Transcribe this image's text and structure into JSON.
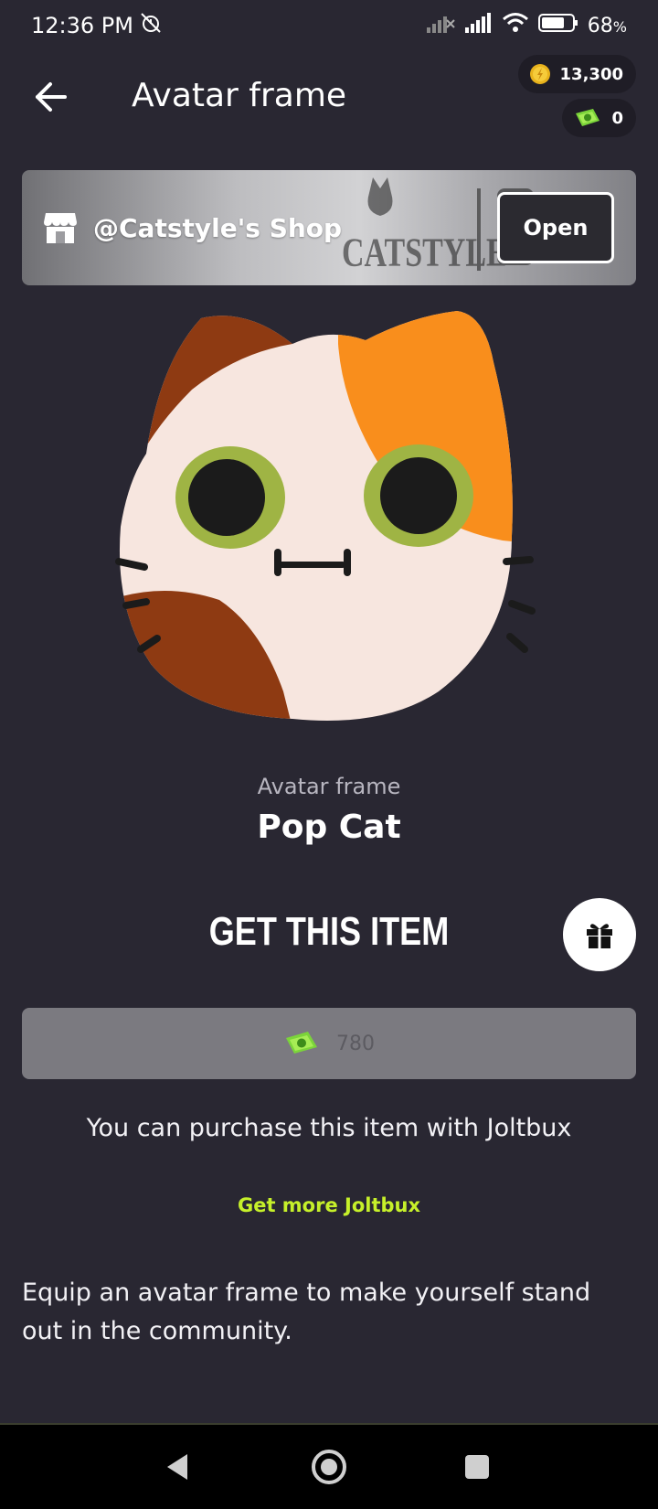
{
  "status_bar": {
    "time": "12:36 PM",
    "battery": "68",
    "battery_suffix": "%"
  },
  "header": {
    "title": "Avatar frame",
    "coins": "13,300",
    "joltbux": "0"
  },
  "shop": {
    "name": "@Catstyle's Shop",
    "open_label": "Open",
    "logo_text": "CATSTYLE"
  },
  "item": {
    "type": "Avatar frame",
    "name": "Pop Cat"
  },
  "purchase": {
    "heading": "GET THIS ITEM",
    "price": "780",
    "note": "You can purchase this item with Joltbux",
    "get_more_label": "Get more Joltbux"
  },
  "description": "Equip an avatar frame to make yourself stand out in the community.",
  "colors": {
    "background": "#292732",
    "accent_link": "#c6f02a",
    "price_button": "#7b7a80"
  }
}
